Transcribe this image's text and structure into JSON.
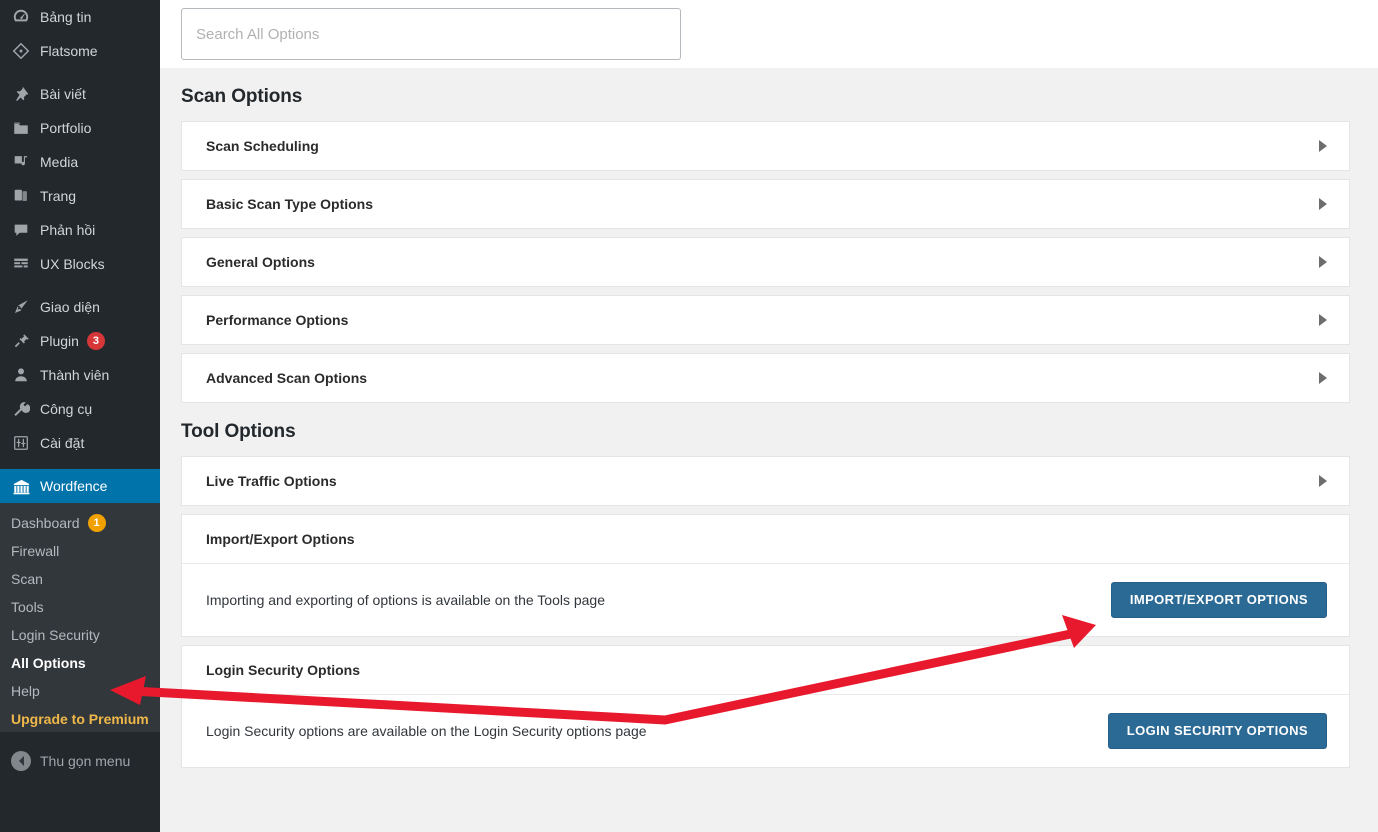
{
  "sidebar": {
    "items": [
      {
        "label": "Bảng tin",
        "icon": "dashboard-icon"
      },
      {
        "label": "Flatsome",
        "icon": "diamond-icon"
      },
      {
        "label": "Bài viết",
        "icon": "pin-icon"
      },
      {
        "label": "Portfolio",
        "icon": "portfolio-icon"
      },
      {
        "label": "Media",
        "icon": "media-icon"
      },
      {
        "label": "Trang",
        "icon": "pages-icon"
      },
      {
        "label": "Phản hồi",
        "icon": "comments-icon"
      },
      {
        "label": "UX Blocks",
        "icon": "blocks-icon"
      },
      {
        "label": "Giao diện",
        "icon": "appearance-icon"
      },
      {
        "label": "Plugin",
        "icon": "plugin-icon",
        "badge": "3",
        "badge_color": "#d63638"
      },
      {
        "label": "Thành viên",
        "icon": "users-icon"
      },
      {
        "label": "Công cụ",
        "icon": "tools-icon"
      },
      {
        "label": "Cài đặt",
        "icon": "settings-icon"
      },
      {
        "label": "Wordfence",
        "icon": "wordfence-icon",
        "current": true
      }
    ],
    "submenu": [
      {
        "label": "Dashboard",
        "badge": "1",
        "badge_color": "#f0a000"
      },
      {
        "label": "Firewall"
      },
      {
        "label": "Scan"
      },
      {
        "label": "Tools"
      },
      {
        "label": "Login Security"
      },
      {
        "label": "All Options",
        "active": true
      },
      {
        "label": "Help"
      },
      {
        "label": "Upgrade to Premium",
        "premium": true
      }
    ],
    "collapse_label": "Thu gọn menu",
    "collapse_icon": "collapse-arrow-icon"
  },
  "search": {
    "placeholder": "Search All Options",
    "value": ""
  },
  "sections": [
    {
      "title": "Scan Options",
      "rows": [
        {
          "title": "Scan Scheduling",
          "collapsed": true
        },
        {
          "title": "Basic Scan Type Options",
          "collapsed": true
        },
        {
          "title": "General Options",
          "collapsed": true
        },
        {
          "title": "Performance Options",
          "collapsed": true
        },
        {
          "title": "Advanced Scan Options",
          "collapsed": true
        }
      ]
    },
    {
      "title": "Tool Options",
      "rows": [
        {
          "title": "Live Traffic Options",
          "collapsed": true
        },
        {
          "title": "Import/Export Options",
          "collapsed": false,
          "body_text": "Importing and exporting of options is available on the Tools page",
          "button_label": "IMPORT/EXPORT OPTIONS"
        },
        {
          "title": "Login Security Options",
          "collapsed": false,
          "body_text": "Login Security options are available on the Login Security options page",
          "button_label": "LOGIN SECURITY OPTIONS"
        }
      ]
    }
  ],
  "colors": {
    "accent_blue": "#0073aa",
    "button_blue": "#2b6a95",
    "annotation_red": "#e8192c",
    "premium_gold": "#f0b849",
    "sidebar_bg": "#23282d",
    "submenu_bg": "#32373c"
  },
  "annotations": {
    "arrow_color": "#e8192c",
    "arrow_description": "red-arrow-pointing-from-import-export-button-to-all-options-menu"
  }
}
